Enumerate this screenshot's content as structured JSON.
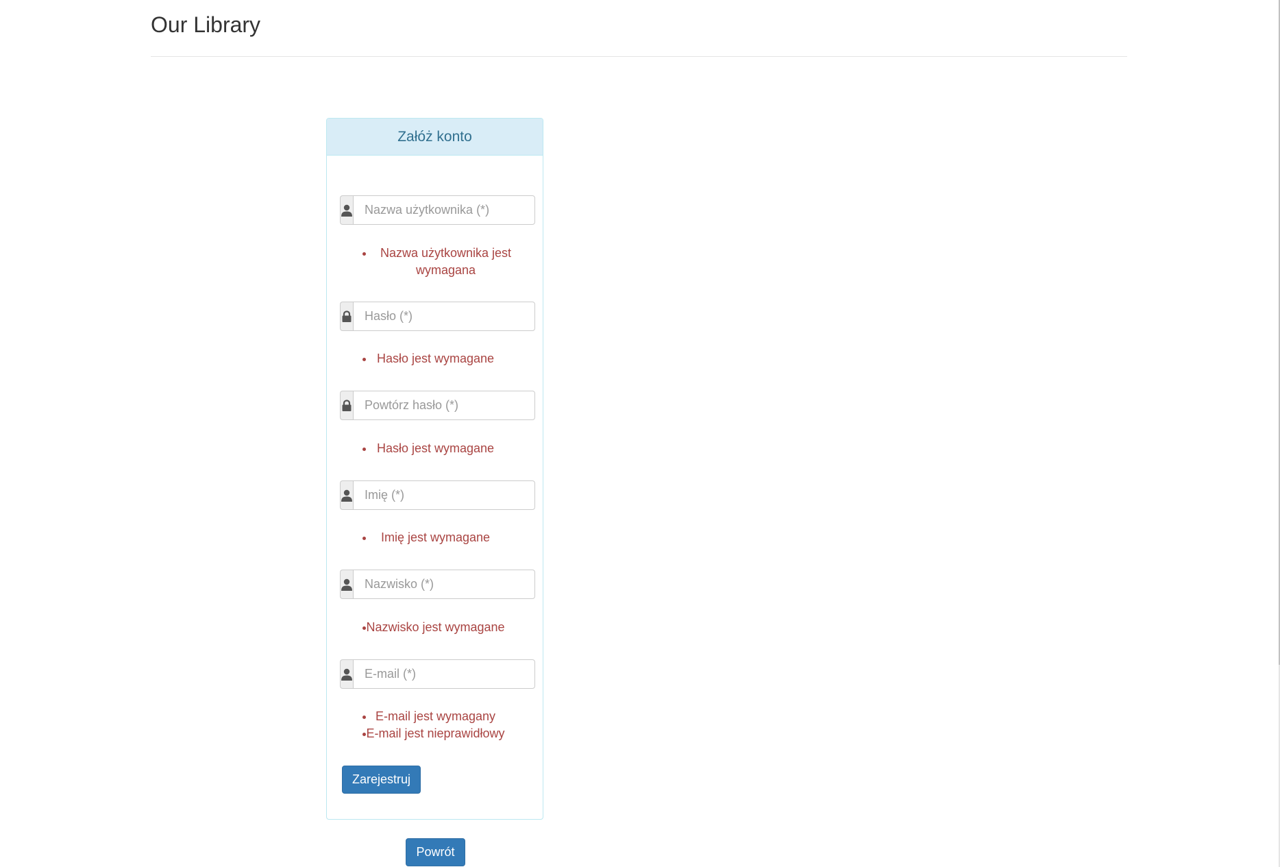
{
  "header": {
    "title": "Our Library"
  },
  "panel": {
    "heading": "Załóż konto"
  },
  "fields": [
    {
      "icon": "user-icon",
      "placeholder": "Nazwa użytkownika (*)",
      "value": "",
      "errors": [
        "Nazwa użytkownika jest wymagana"
      ]
    },
    {
      "icon": "lock-icon",
      "placeholder": "Hasło (*)",
      "value": "",
      "errors": [
        "Hasło jest wymagane"
      ]
    },
    {
      "icon": "lock-icon",
      "placeholder": "Powtórz hasło (*)",
      "value": "",
      "errors": [
        "Hasło jest wymagane"
      ]
    },
    {
      "icon": "user-icon",
      "placeholder": "Imię (*)",
      "value": "",
      "errors": [
        "Imię jest wymagane"
      ]
    },
    {
      "icon": "user-icon",
      "placeholder": "Nazwisko (*)",
      "value": "",
      "errors": [
        "Nazwisko jest wymagane"
      ]
    },
    {
      "icon": "user-icon",
      "placeholder": "E-mail (*)",
      "value": "",
      "errors": [
        "E-mail jest wymagany",
        "E-mail jest nieprawidłowy"
      ]
    }
  ],
  "buttons": {
    "register": "Zarejestruj",
    "back": "Powrót"
  },
  "colors": {
    "primary": "#337ab7",
    "panel_heading_bg": "#d9edf7",
    "panel_heading_text": "#31708f",
    "error": "#a94442"
  }
}
